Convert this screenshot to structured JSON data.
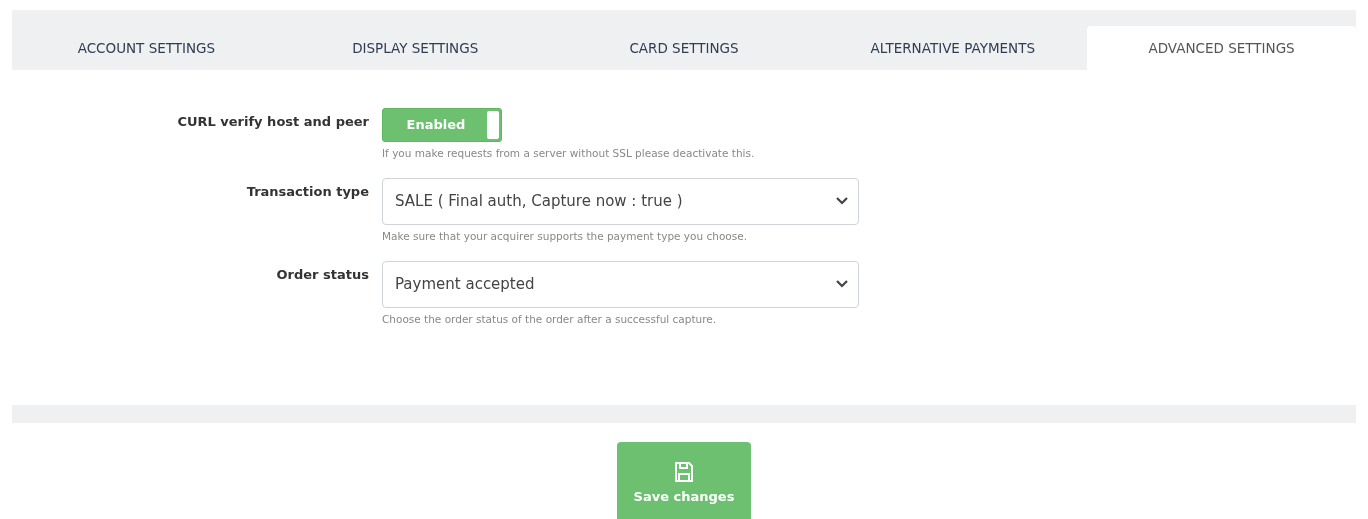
{
  "tabs": [
    {
      "label": "ACCOUNT SETTINGS",
      "selected": false
    },
    {
      "label": "DISPLAY SETTINGS",
      "selected": false
    },
    {
      "label": "CARD SETTINGS",
      "selected": false
    },
    {
      "label": "ALTERNATIVE PAYMENTS",
      "selected": false
    },
    {
      "label": "ADVANCED SETTINGS",
      "selected": true
    }
  ],
  "fields": [
    {
      "kind": "toggle",
      "label": "CURL verify host and peer",
      "on": true,
      "value": "Enabled",
      "help": "If you make requests from a server without SSL please deactivate this."
    },
    {
      "kind": "select",
      "label": "Transaction type",
      "value": "SALE ( Final auth, Capture now : true )",
      "help": "Make sure that your acquirer supports the payment type you choose."
    },
    {
      "kind": "select",
      "label": "Order status",
      "value": "Payment accepted",
      "help": "Choose the order status of the order after a successful capture."
    }
  ],
  "save_button": "Save changes"
}
